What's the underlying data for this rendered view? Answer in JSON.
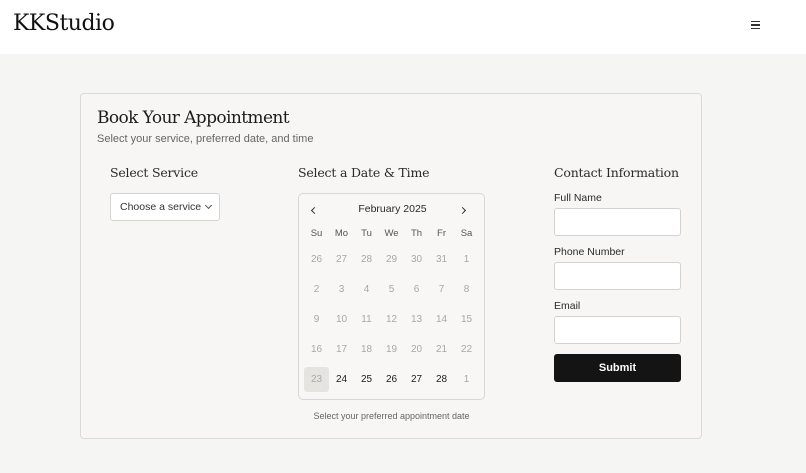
{
  "header": {
    "logo": "KKStudio",
    "menu_icon": "hamburger-menu-icon"
  },
  "booking": {
    "title": "Book Your Appointment",
    "subtitle": "Select your service, preferred date, and time",
    "service": {
      "heading": "Select Service",
      "select_value": "Choose a service"
    },
    "datetime": {
      "heading": "Select a Date & Time",
      "month_label": "February 2025",
      "weekdays": [
        "Su",
        "Mo",
        "Tu",
        "We",
        "Th",
        "Fr",
        "Sa"
      ],
      "weeks": [
        [
          "26",
          "27",
          "28",
          "29",
          "30",
          "31",
          "1"
        ],
        [
          "2",
          "3",
          "4",
          "5",
          "6",
          "7",
          "8"
        ],
        [
          "9",
          "10",
          "11",
          "12",
          "13",
          "14",
          "15"
        ],
        [
          "16",
          "17",
          "18",
          "19",
          "20",
          "21",
          "22"
        ],
        [
          "23",
          "24",
          "25",
          "26",
          "27",
          "28",
          "1"
        ]
      ],
      "available_days": [
        "24",
        "25",
        "26",
        "27",
        "28"
      ],
      "highlighted_day": "23",
      "note": "Select your preferred appointment date"
    },
    "contact": {
      "heading": "Contact Information",
      "full_name_label": "Full Name",
      "full_name_value": "",
      "phone_label": "Phone Number",
      "phone_value": "",
      "email_label": "Email",
      "email_value": "",
      "submit_label": "Submit"
    }
  },
  "colors": {
    "page_bg": "#f5f5f4",
    "card_bg": "#f7f6f4",
    "button_bg": "#141414",
    "button_text": "#ffffff"
  }
}
